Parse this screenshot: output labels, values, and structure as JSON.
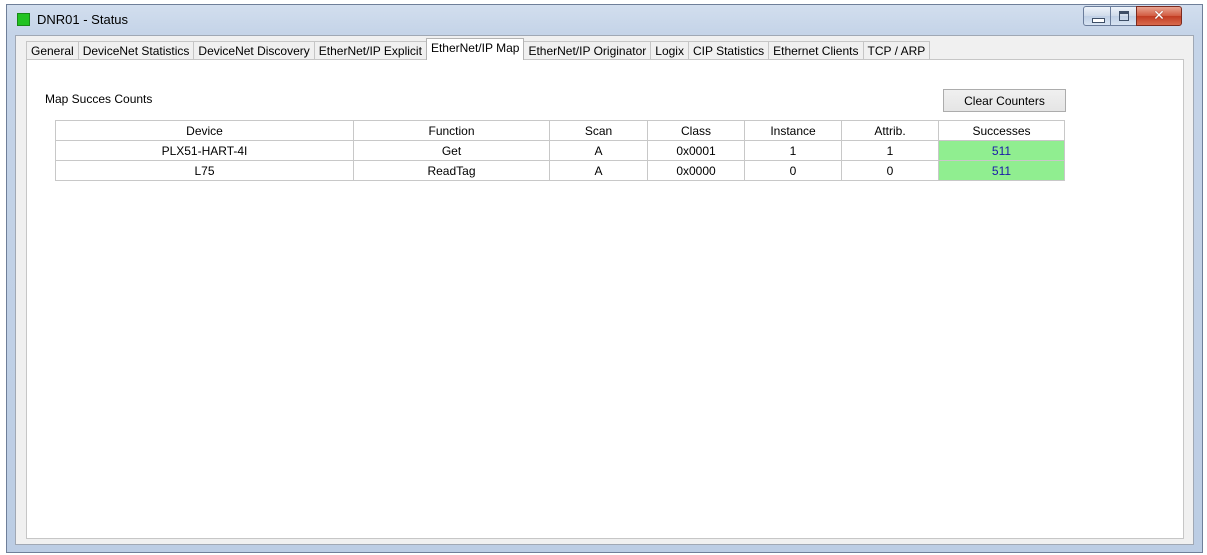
{
  "window": {
    "title": "DNR01 - Status",
    "icon": "green-status-icon",
    "close_glyph": "✕"
  },
  "tabs": [
    {
      "label": "General"
    },
    {
      "label": "DeviceNet Statistics"
    },
    {
      "label": "DeviceNet Discovery"
    },
    {
      "label": "EtherNet/IP Explicit"
    },
    {
      "label": "EtherNet/IP Map",
      "active": true
    },
    {
      "label": "EtherNet/IP Originator"
    },
    {
      "label": "Logix"
    },
    {
      "label": "CIP Statistics"
    },
    {
      "label": "Ethernet Clients"
    },
    {
      "label": "TCP / ARP"
    }
  ],
  "map": {
    "section_label": "Map Succes Counts",
    "clear_button": "Clear Counters",
    "columns": [
      "Device",
      "Function",
      "Scan",
      "Class",
      "Instance",
      "Attrib.",
      "Successes"
    ],
    "rows": [
      [
        "PLX51-HART-4I",
        "Get",
        "A",
        "0x0001",
        "1",
        "1",
        "511"
      ],
      [
        "L75",
        "ReadTag",
        "A",
        "0x0000",
        "0",
        "0",
        "511"
      ]
    ],
    "success_color": "#90ee90"
  }
}
